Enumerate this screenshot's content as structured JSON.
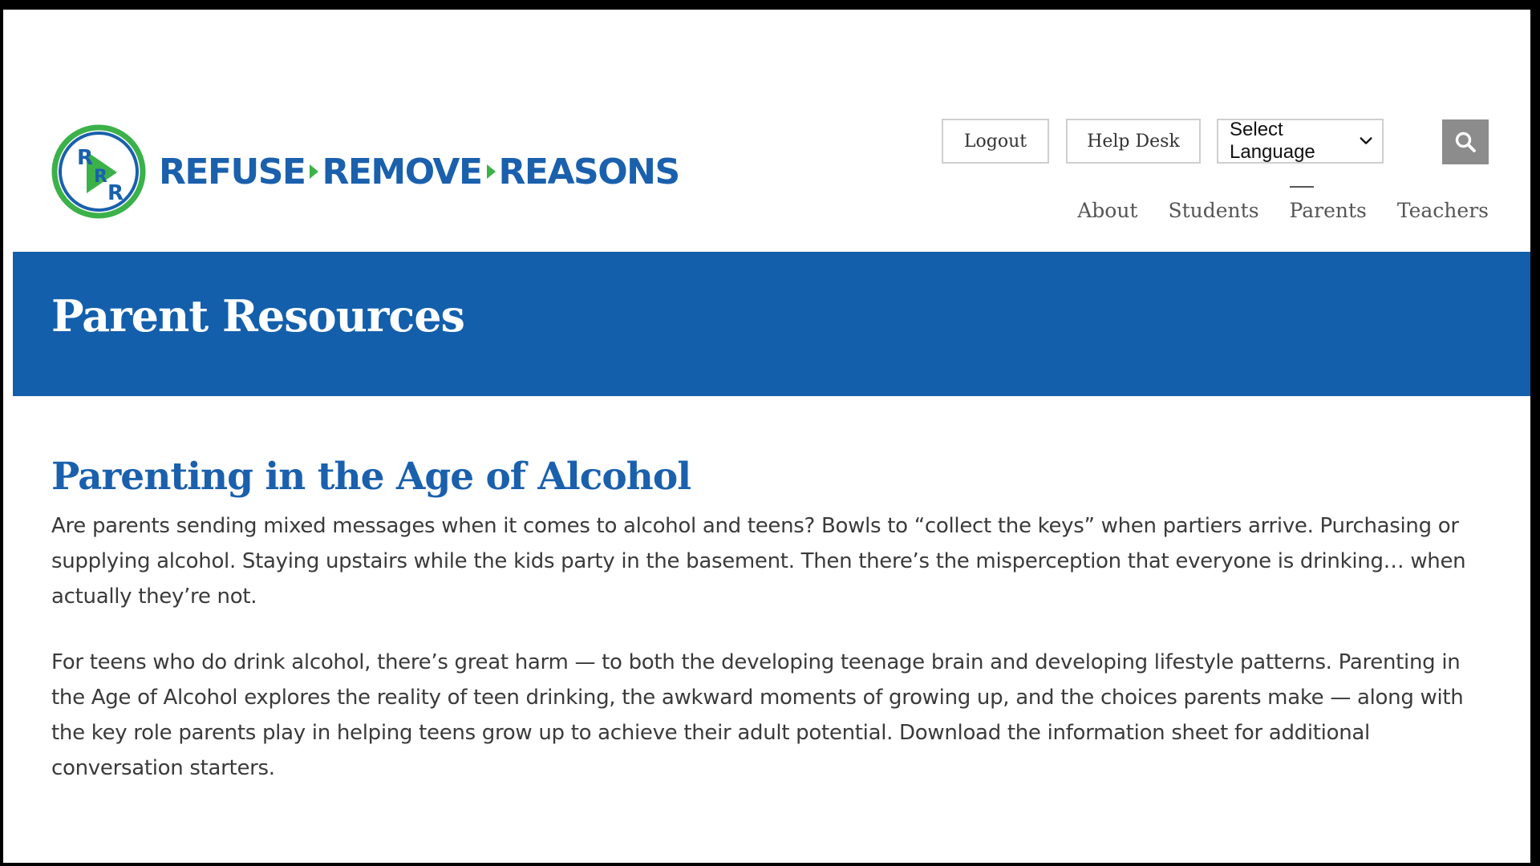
{
  "header": {
    "logo_mark": {
      "letter_top": "R",
      "letter_mid": "R",
      "letter_bottom": "R"
    },
    "logo_words": [
      "REFUSE",
      "REMOVE",
      "REASONS"
    ],
    "logout_label": "Logout",
    "helpdesk_label": "Help Desk",
    "language_select": {
      "selected": "Select Language"
    },
    "search_icon": "search-icon"
  },
  "nav": {
    "items": [
      {
        "label": "About"
      },
      {
        "label": "Students"
      },
      {
        "label": "Parents",
        "active": true
      },
      {
        "label": "Teachers"
      }
    ]
  },
  "banner": {
    "title": "Parent Resources"
  },
  "article": {
    "title": "Parenting in the Age of Alcohol",
    "paragraphs": [
      "Are parents sending mixed messages when it comes to alcohol and teens? Bowls to “collect the keys” when partiers arrive. Purchasing or supplying alcohol. Staying upstairs while the kids party in the basement. Then there’s the misperception that everyone is drinking… when actually they’re not.",
      "For teens who do drink alcohol, there’s great harm — to both the developing teenage brain and developing lifestyle patterns. Parenting in the Age of Alcohol explores the reality of teen drinking, the awkward moments of growing up, and the choices parents make — along with the key role parents play in helping teens grow up to achieve their adult potential. Download the information sheet for additional conversation starters."
    ]
  },
  "colors": {
    "brand_blue": "#1a60ad",
    "banner_blue": "#135fac",
    "brand_green": "#3cb14a",
    "search_gray": "#8c8c8c"
  }
}
